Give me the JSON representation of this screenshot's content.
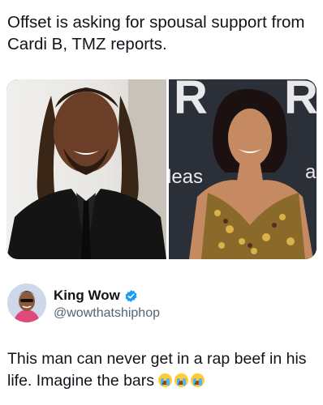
{
  "post": {
    "headline": "Offset is asking for spousal support from Cardi B, TMZ reports."
  },
  "photos": {
    "left_alt_icon": "man-in-black-suit-photo",
    "right_alt_icon": "woman-in-sequin-dress-photo",
    "right_backdrop_text_top": "R",
    "right_backdrop_text_mid": "leas"
  },
  "author": {
    "display_name": "King Wow",
    "handle": "@wowthatshiphop",
    "verified_icon": "verified-badge-icon",
    "verified_color": "#1d9bf0"
  },
  "tweet": {
    "text": "This man can never get in a rap beef in his life. Imagine the bars",
    "emoji_icon": "loudly-crying-face-icon",
    "emoji_count": 3
  },
  "colors": {
    "text_primary": "#0f1419",
    "text_secondary": "#536471",
    "background": "#ffffff"
  }
}
